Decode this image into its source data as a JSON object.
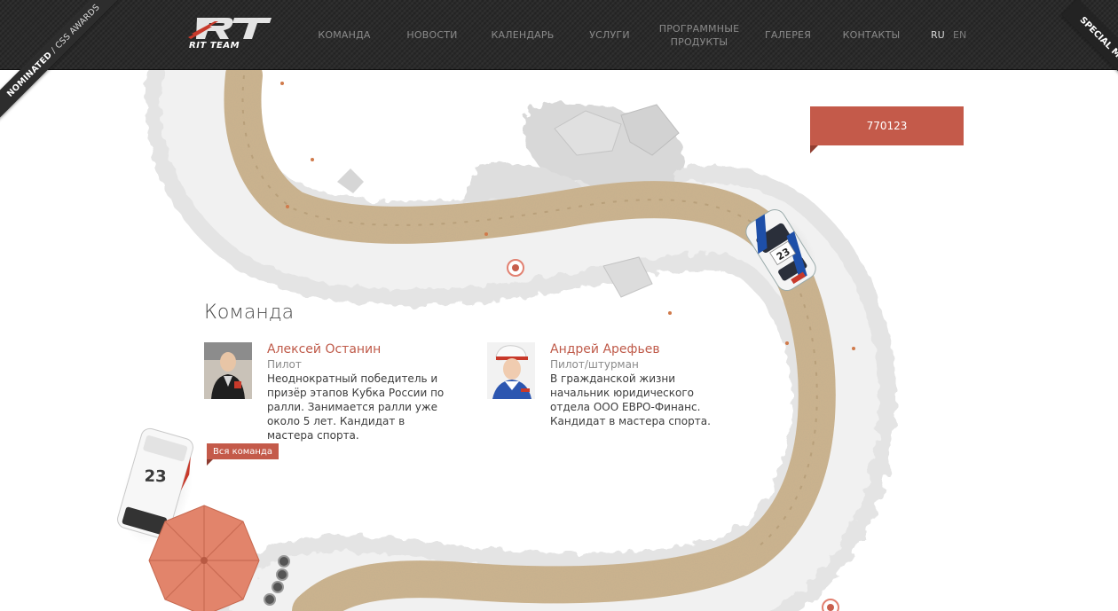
{
  "colors": {
    "header_bg": "#2b2b2b",
    "accent": "#c45a4a",
    "nav_text": "#8a8a8a",
    "road": "#cdb48e",
    "gravel": "#dedede"
  },
  "logo": {
    "mark": "RT",
    "text": "RIT TEAM"
  },
  "nav": {
    "items": [
      {
        "label": "КОМАНДА"
      },
      {
        "label": "НОВОСТИ"
      },
      {
        "label": "КАЛЕНДАРЬ"
      },
      {
        "label": "УСЛУГИ"
      },
      {
        "label": "ПРОГРАММНЫЕ ПРОДУКТЫ"
      },
      {
        "label": "ГАЛЕРЕЯ"
      },
      {
        "label": "КОНТАКТЫ"
      }
    ],
    "lang_ru": "RU",
    "lang_en": "EN"
  },
  "ribbons": {
    "left_bold": "NOMINATED",
    "left_thin": "/ CSS AWARDS",
    "right": "SPECIAL MENTION"
  },
  "badge": {
    "value": "770123"
  },
  "team": {
    "title": "Команда",
    "members": [
      {
        "name": "Алексей Останин",
        "role": "Пилот",
        "desc": "Неоднократный победитель и призёр этапов Кубка России по ралли. Занимается ралли уже около 5 лет. Кандидат в мастера спорта."
      },
      {
        "name": "Андрей Арефьев",
        "role": "Пилот/штурман",
        "desc": "В гражданской жизни начальник юридического отдела ООО ЕВРО-Финанс. Кандидат в мастера спорта."
      }
    ],
    "all_button": "Вся команда"
  },
  "car_number": "23"
}
